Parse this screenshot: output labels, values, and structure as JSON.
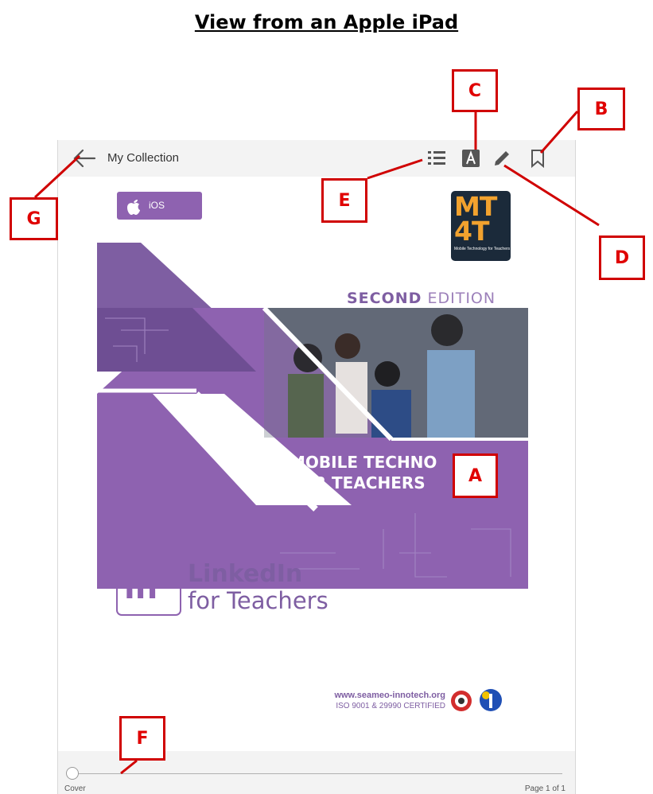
{
  "heading": "View from an Apple iPad",
  "reader": {
    "collection_label": "My Collection",
    "icons": [
      "back-arrow-icon",
      "table-of-contents-icon",
      "text-size-icon",
      "pencil-icon",
      "bookmark-icon"
    ],
    "slider_left_label": "Cover",
    "page_indicator": "Page 1 of 1",
    "slider_value": 0
  },
  "book": {
    "platform_badge": "iOS",
    "edition_bold": "SECOND",
    "edition_rest": " EDITION",
    "series_line1": "MOBILE TECHNO",
    "series_line2": "FOR TEACHERS",
    "badge_text": "MT\n4T",
    "badge_subtitle": "Mobile Technology for Teachers",
    "linkedin_logo": "in",
    "title_line1": "LinkedIn",
    "title_line2": "for Teachers",
    "website": "www.seameo-innotech.org",
    "certification": "ISO 9001 & 29990 CERTIFIED",
    "icon_logo": "apple-icon"
  },
  "callouts": {
    "a": "A",
    "b": "B",
    "c": "C",
    "d": "D",
    "e": "E",
    "f": "F",
    "g": "G"
  },
  "colors": {
    "purple": "#8e62b0",
    "callout_red": "#d00000",
    "toolbar_bg": "#f3f3f3"
  }
}
